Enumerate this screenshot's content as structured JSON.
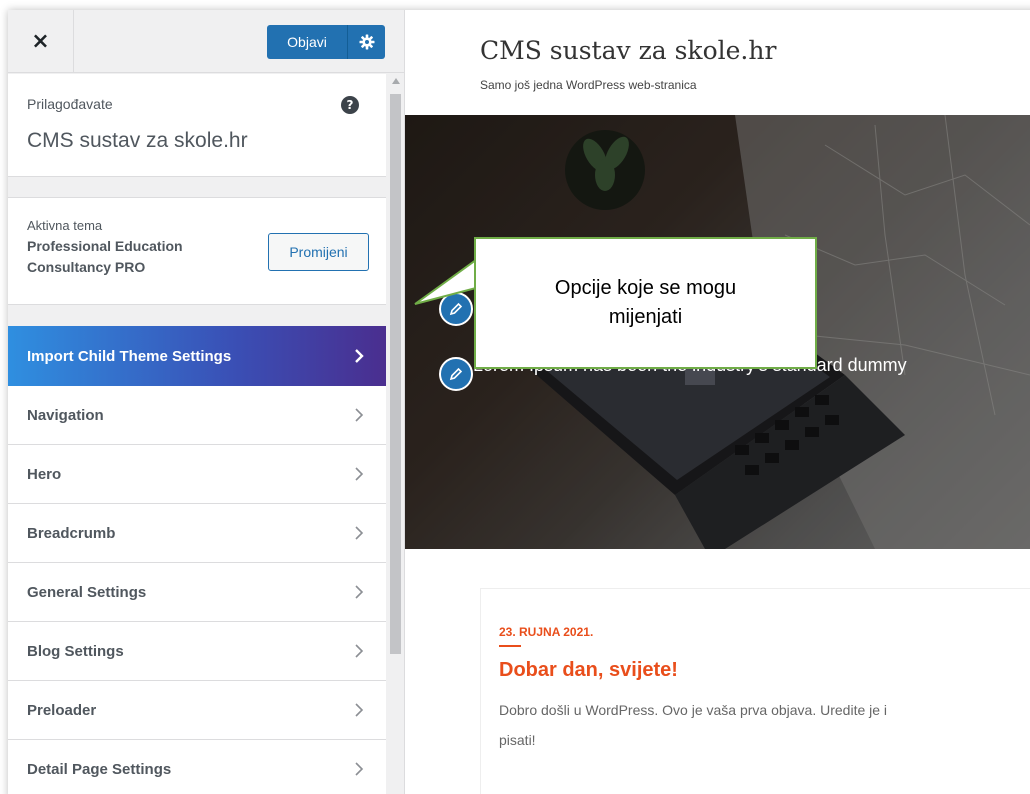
{
  "sidebar": {
    "close_label": "×",
    "publish_label": "Objavi",
    "info": {
      "label": "Prilagođavate",
      "title": "CMS sustav za skole.hr",
      "help_glyph": "?"
    },
    "theme": {
      "label": "Aktivna tema",
      "name": "Professional Education Consultancy PRO",
      "change_label": "Promijeni"
    },
    "menu": [
      {
        "label": "Import Child Theme Settings",
        "active": true
      },
      {
        "label": "Navigation"
      },
      {
        "label": "Hero"
      },
      {
        "label": "Breadcrumb"
      },
      {
        "label": "General Settings"
      },
      {
        "label": "Blog Settings"
      },
      {
        "label": "Preloader"
      },
      {
        "label": "Detail Page Settings"
      }
    ]
  },
  "preview": {
    "site_title": "CMS sustav za skole.hr",
    "tagline": "Samo još jedna WordPress web-stranica",
    "hero_text": "Lorem Ipsum has been the industry's standard dummy",
    "post": {
      "date": "23. RUJNA 2021.",
      "title": "Dobar dan, svijete!",
      "excerpt_line1": "Dobro došli u WordPress. Ovo je vaša prva objava. Uredite je i",
      "excerpt_line2": "pisati!"
    }
  },
  "callout": {
    "line1": "Opcije koje se mogu",
    "line2": "mijenjati"
  },
  "colors": {
    "accent_blue": "#2271b1",
    "post_orange": "#e94e1b",
    "callout_border": "#70ad47",
    "active_gradient_start": "#2f8fe0",
    "active_gradient_end": "#4a2e8f"
  }
}
